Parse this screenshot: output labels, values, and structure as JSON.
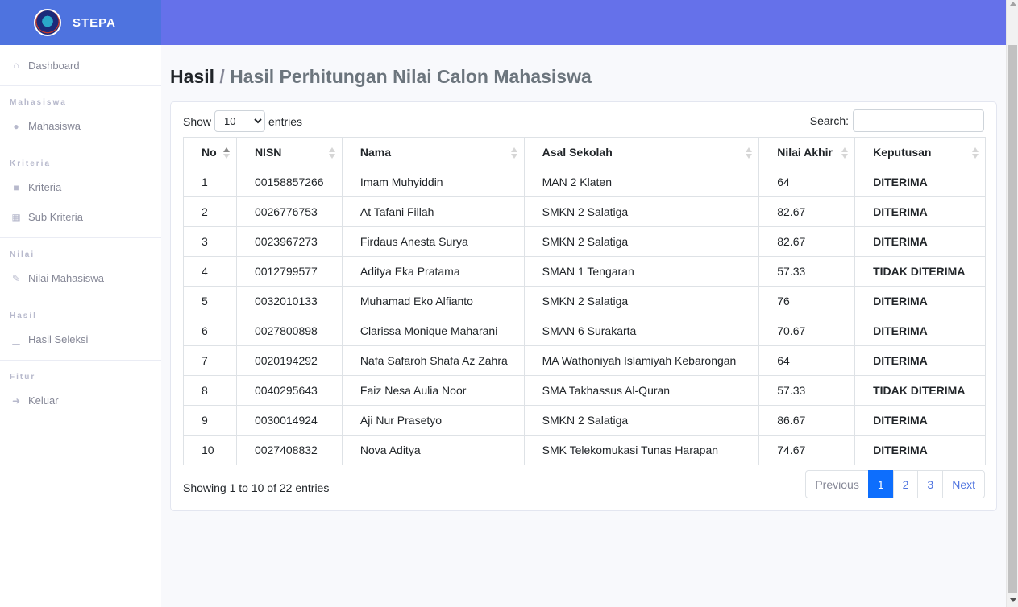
{
  "brand": {
    "name": "STEPA"
  },
  "sidebar": {
    "dashboard": "Dashboard",
    "sections": [
      {
        "heading": "Mahasiswa",
        "items": [
          {
            "label": "Mahasiswa",
            "icon": "users-icon"
          }
        ]
      },
      {
        "heading": "Kriteria",
        "items": [
          {
            "label": "Kriteria",
            "icon": "cube-icon"
          },
          {
            "label": "Sub Kriteria",
            "icon": "cubes-icon"
          }
        ]
      },
      {
        "heading": "Nilai",
        "items": [
          {
            "label": "Nilai Mahasiswa",
            "icon": "edit-icon"
          }
        ]
      },
      {
        "heading": "Hasil",
        "items": [
          {
            "label": "Hasil Seleksi",
            "icon": "chart-icon"
          }
        ]
      },
      {
        "heading": "Fitur",
        "items": [
          {
            "label": "Keluar",
            "icon": "sign-out-icon"
          }
        ]
      }
    ]
  },
  "page": {
    "title": "Hasil",
    "separator": "/",
    "subtitle": "Hasil Perhitungan Nilai Calon Mahasiswa"
  },
  "table_controls": {
    "show_label": "Show",
    "entries_label": "entries",
    "page_length": "10",
    "search_label": "Search:",
    "search_value": ""
  },
  "table": {
    "columns": [
      "No",
      "NISN",
      "Nama",
      "Asal Sekolah",
      "Nilai Akhir",
      "Keputusan"
    ],
    "rows": [
      [
        "1",
        "00158857266",
        "Imam Muhyiddin",
        "MAN 2 Klaten",
        "64",
        "DITERIMA"
      ],
      [
        "2",
        "0026776753",
        "At Tafani Fillah",
        "SMKN 2 Salatiga",
        "82.67",
        "DITERIMA"
      ],
      [
        "3",
        "0023967273",
        "Firdaus Anesta Surya",
        "SMKN 2 Salatiga",
        "82.67",
        "DITERIMA"
      ],
      [
        "4",
        "0012799577",
        "Aditya Eka Pratama",
        "SMAN 1 Tengaran",
        "57.33",
        "TIDAK DITERIMA"
      ],
      [
        "5",
        "0032010133",
        "Muhamad Eko Alfianto",
        "SMKN 2 Salatiga",
        "76",
        "DITERIMA"
      ],
      [
        "6",
        "0027800898",
        "Clarissa Monique Maharani",
        "SMAN 6 Surakarta",
        "70.67",
        "DITERIMA"
      ],
      [
        "7",
        "0020194292",
        "Nafa Safaroh Shafa Az Zahra",
        "MA Wathoniyah Islamiyah Kebarongan",
        "64",
        "DITERIMA"
      ],
      [
        "8",
        "0040295643",
        "Faiz Nesa Aulia Noor",
        "SMA Takhassus Al-Quran",
        "57.33",
        "TIDAK DITERIMA"
      ],
      [
        "9",
        "0030014924",
        "Aji Nur Prasetyo",
        "SMKN 2 Salatiga",
        "86.67",
        "DITERIMA"
      ],
      [
        "10",
        "0027408832",
        "Nova Aditya",
        "SMK Telekomukasi Tunas Harapan",
        "74.67",
        "DITERIMA"
      ]
    ]
  },
  "footer": {
    "info": "Showing 1 to 10 of 22 entries",
    "previous": "Previous",
    "next": "Next",
    "pages": [
      "1",
      "2",
      "3"
    ],
    "active_page": "1"
  },
  "colors": {
    "topbar": "#6571ea",
    "brand": "#4e73df",
    "active_page": "#0d6efd"
  }
}
